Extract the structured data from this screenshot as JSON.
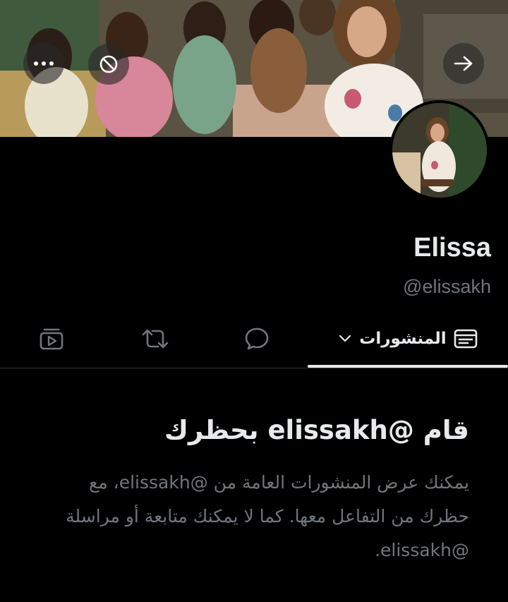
{
  "profile": {
    "display_name": "Elissa",
    "handle": "@elissakh"
  },
  "banner": {
    "more_icon": "more-horizontal-icon",
    "block_icon": "blocked-circle-icon",
    "forward_icon": "arrow-right-icon"
  },
  "tabs": {
    "posts_label": "المنشورات",
    "posts_icon": "posts-list-icon",
    "dropdown_icon": "chevron-down-icon",
    "replies_icon": "speech-bubble-icon",
    "reposts_icon": "repost-icon",
    "media_icon": "video-play-icon"
  },
  "blocked": {
    "title": "قام @elissakh بحظرك",
    "body": "يمكنك عرض المنشورات العامة من @elissakh، مع حظرك من التفاعل معها. كما لا يمكنك متابعة أو مراسلة @elissakh."
  },
  "colors": {
    "background": "#000000",
    "primary_text": "#e7e9ea",
    "secondary_text": "#71767b",
    "divider": "#2f3336"
  }
}
